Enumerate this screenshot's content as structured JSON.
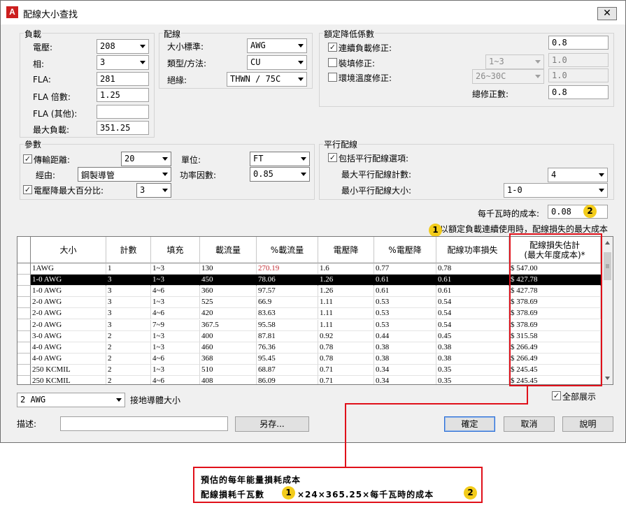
{
  "window": {
    "title": "配線大小查找",
    "close": "✕"
  },
  "load": {
    "title": "負載",
    "voltage_label": "電壓:",
    "voltage": "208",
    "phase_label": "相:",
    "phase": "3",
    "fla_label": "FLA:",
    "fla": "281",
    "fla_mult_label": "FLA 倍數:",
    "fla_mult": "1.25",
    "fla_other_label": "FLA (其他):",
    "fla_other": "",
    "max_load_label": "最大負載:",
    "max_load": "351.25"
  },
  "wiring": {
    "title": "配線",
    "size_std_label": "大小標準:",
    "size_std": "AWG",
    "type_label": "類型/方法:",
    "type": "CU",
    "insul_label": "絕緣:",
    "insul": "THWN / 75C"
  },
  "derating": {
    "title": "額定降低係數",
    "cont_label": "連續負載修正:",
    "cont": "0.8",
    "fill_label": "裝填修正:",
    "fill_sel": "1~3",
    "fill": "1.0",
    "amb_label": "環境溫度修正:",
    "amb_sel": "26~30C",
    "amb": "1.0",
    "total_label": "總修正數:",
    "total": "0.8"
  },
  "params": {
    "title": "參數",
    "dist_label": "傳輸距離:",
    "dist": "20",
    "unit_label": "單位:",
    "unit": "FT",
    "via_label": "經由:",
    "via": "鋼製導管",
    "pf_label": "功率因數:",
    "pf": "0.85",
    "vdrop_label": "電壓降最大百分比:",
    "vdrop": "3"
  },
  "parallel": {
    "title": "平行配線",
    "include_label": "包括平行配線選項:",
    "max_count_label": "最大平行配線計數:",
    "max_count": "4",
    "min_size_label": "最小平行配線大小:",
    "min_size": "1-0"
  },
  "cost": {
    "label": "每千瓦時的成本:",
    "value": "0.08",
    "note": "以額定負載連續使用時，配線損失的最大成本"
  },
  "grid": {
    "headers": [
      "大小",
      "計數",
      "填充",
      "載流量",
      "%載流量",
      "電壓降",
      "%電壓降",
      "配線功率損失",
      "配線損失估計\n(最大年度成本)*"
    ],
    "rows": [
      [
        "1AWG",
        "1",
        "1~3",
        "130",
        "270.19",
        "1.6",
        "0.77",
        "0.78",
        "$ 547.00"
      ],
      [
        "1-0 AWG",
        "3",
        "1~3",
        "450",
        "78.06",
        "1.26",
        "0.61",
        "0.61",
        "$ 427.78"
      ],
      [
        "1-0 AWG",
        "3",
        "4~6",
        "360",
        "97.57",
        "1.26",
        "0.61",
        "0.61",
        "$ 427.78"
      ],
      [
        "2-0 AWG",
        "3",
        "1~3",
        "525",
        "66.9",
        "1.11",
        "0.53",
        "0.54",
        "$ 378.69"
      ],
      [
        "2-0 AWG",
        "3",
        "4~6",
        "420",
        "83.63",
        "1.11",
        "0.53",
        "0.54",
        "$ 378.69"
      ],
      [
        "2-0 AWG",
        "3",
        "7~9",
        "367.5",
        "95.58",
        "1.11",
        "0.53",
        "0.54",
        "$ 378.69"
      ],
      [
        "3-0 AWG",
        "2",
        "1~3",
        "400",
        "87.81",
        "0.92",
        "0.44",
        "0.45",
        "$ 315.58"
      ],
      [
        "4-0 AWG",
        "2",
        "1~3",
        "460",
        "76.36",
        "0.78",
        "0.38",
        "0.38",
        "$ 266.49"
      ],
      [
        "4-0 AWG",
        "2",
        "4~6",
        "368",
        "95.45",
        "0.78",
        "0.38",
        "0.38",
        "$ 266.49"
      ],
      [
        "250 KCMIL",
        "2",
        "1~3",
        "510",
        "68.87",
        "0.71",
        "0.34",
        "0.35",
        "$ 245.45"
      ],
      [
        "250 KCMIL",
        "2",
        "4~6",
        "408",
        "86.09",
        "0.71",
        "0.34",
        "0.35",
        "$ 245.45"
      ]
    ],
    "selected_row": 1,
    "warn_color": "#c0262c"
  },
  "ground": {
    "value": "2 AWG",
    "label": "接地導體大小"
  },
  "show_all_label": "全部展示",
  "desc": {
    "label": "描述:",
    "value": "",
    "save_as": "另存..."
  },
  "buttons": {
    "ok": "確定",
    "cancel": "取消",
    "help": "說明"
  },
  "badges": {
    "one": "1",
    "two": "2"
  },
  "annotation": {
    "line1": "預估的每年能量損耗成本",
    "line2_a": "配線損耗千瓦數",
    "line2_b": "×24×365.25×每千瓦時的成本"
  },
  "colors": {
    "accent_red": "#e0101a",
    "badge_yellow": "#f3cc1b"
  }
}
